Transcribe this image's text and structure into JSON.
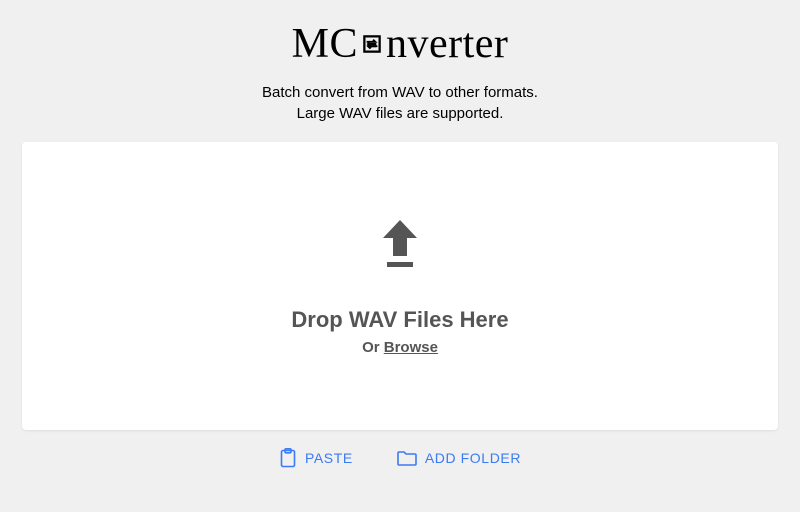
{
  "logo": {
    "prefix": "MC",
    "suffix": "nverter"
  },
  "subtitle": {
    "line1": "Batch convert from WAV to other formats.",
    "line2": "Large WAV files are supported."
  },
  "dropzone": {
    "title": "Drop WAV Files Here",
    "or": "Or ",
    "browse": "Browse"
  },
  "actions": {
    "paste": "PASTE",
    "addFolder": "ADD FOLDER"
  },
  "colors": {
    "accent": "#3b7af5",
    "iconGray": "#555"
  }
}
